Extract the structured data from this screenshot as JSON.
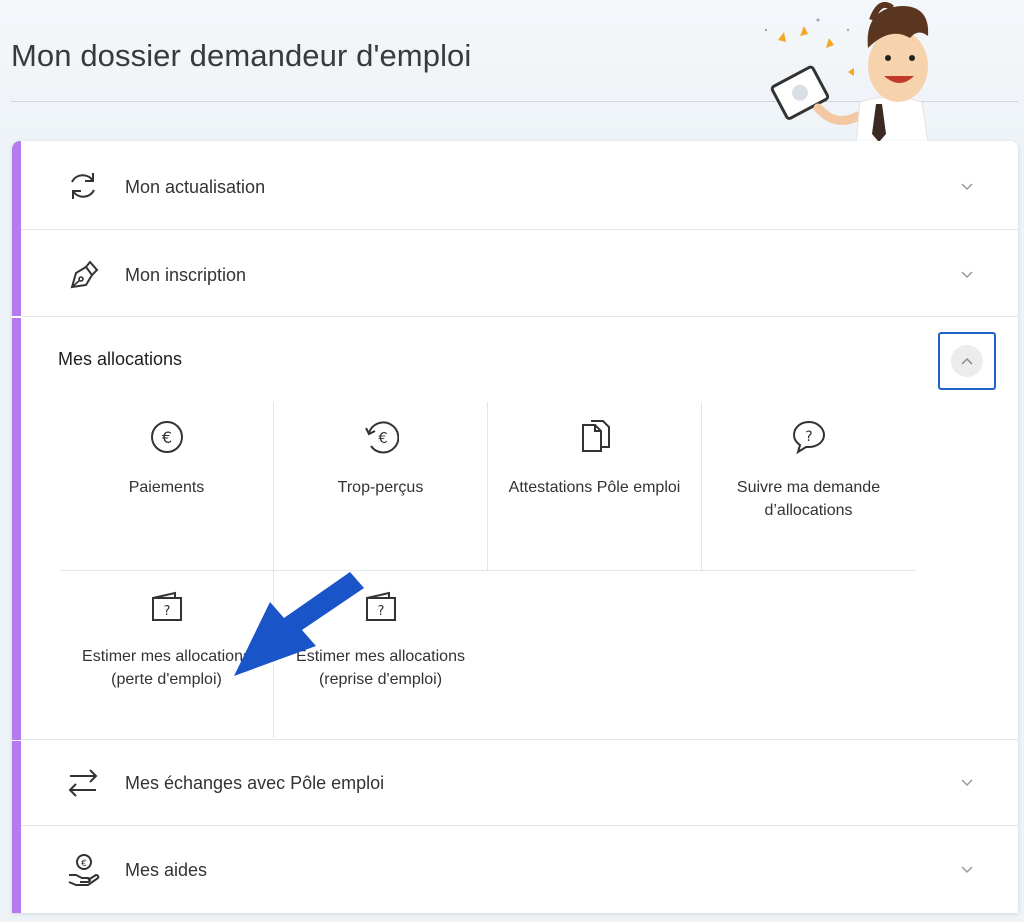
{
  "page": {
    "title": "Mon dossier demandeur d'emploi"
  },
  "sections": {
    "actualisation": {
      "label": "Mon actualisation",
      "icon": "refresh-icon"
    },
    "inscription": {
      "label": "Mon inscription",
      "icon": "pen-icon"
    },
    "allocations": {
      "label": "Mes allocations",
      "expanded": true
    },
    "echanges": {
      "label": "Mes échanges avec Pôle emploi",
      "icon": "exchange-icon"
    },
    "aides": {
      "label": "Mes aides",
      "icon": "hand-euro-icon"
    }
  },
  "tiles": [
    {
      "label": "Paiements",
      "icon": "euro-icon"
    },
    {
      "label": "Trop-perçus",
      "icon": "euro-refund-icon"
    },
    {
      "label": "Attestations Pôle emploi",
      "icon": "documents-icon"
    },
    {
      "label": "Suivre ma demande d’allocations",
      "icon": "question-bubble-icon"
    },
    {
      "label": "Estimer mes allocations (perte d'emploi)",
      "icon": "wallet-question-icon"
    },
    {
      "label": "Estimer mes allocations (reprise d'emploi)",
      "icon": "wallet-question-icon"
    }
  ],
  "colors": {
    "accent": "#b579f0",
    "focus": "#1e63c9",
    "arrow": "#1a54c9"
  }
}
